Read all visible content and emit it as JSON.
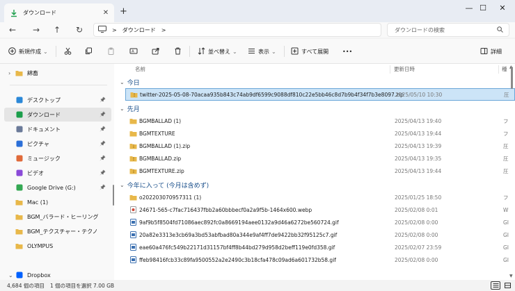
{
  "tab": {
    "label": "ダウンロード"
  },
  "window": {
    "minimize": "—",
    "maximize": "☐",
    "close": "✕"
  },
  "nav": {
    "back": "←",
    "forward": "→",
    "up": "↑",
    "refresh": "↻"
  },
  "address": {
    "crumb": "ダウンロード",
    "sep1": ">",
    "sep2": ">"
  },
  "search": {
    "placeholder": "ダウンロードの検索"
  },
  "toolbar": {
    "new": "新規作成",
    "sort": "並べ替え",
    "view": "表示",
    "expand_all": "すべて展開",
    "more": "•••",
    "details": "詳細"
  },
  "sidebar": {
    "items": [
      {
        "label": "綿畜",
        "icon": "folder-icon",
        "color": "#e8b84a",
        "expand": "›"
      },
      {
        "label": "デスクトップ",
        "icon": "desktop-icon",
        "color": "#2b88d8"
      },
      {
        "label": "ダウンロード",
        "icon": "download-icon",
        "color": "#1b9e4b"
      },
      {
        "label": "ドキュメント",
        "icon": "document-icon",
        "color": "#6b7a99"
      },
      {
        "label": "ピクチャ",
        "icon": "pictures-icon",
        "color": "#2b6fd8"
      },
      {
        "label": "ミュージック",
        "icon": "music-icon",
        "color": "#e06a3a"
      },
      {
        "label": "ビデオ",
        "icon": "video-icon",
        "color": "#8a4ad8"
      },
      {
        "label": "Google Drive (G:)",
        "icon": "google-drive-icon",
        "color": "#34a853"
      },
      {
        "label": "Mac (1)",
        "icon": "folder-icon",
        "color": "#e8b84a"
      },
      {
        "label": "BGM_バラード・ヒーリング",
        "icon": "folder-icon",
        "color": "#e8b84a"
      },
      {
        "label": "BGM_テクスチャー・テクノ",
        "icon": "folder-icon",
        "color": "#e8b84a"
      },
      {
        "label": "OLYMPUS",
        "icon": "folder-icon",
        "color": "#e8b84a"
      },
      {
        "label": "Dropbox",
        "icon": "dropbox-icon",
        "color": "#0061fe",
        "expand": "⌄"
      }
    ]
  },
  "columns": {
    "name": "名前",
    "date": "更新日時",
    "type": "種"
  },
  "groups": [
    {
      "title": "今日",
      "rows": [
        {
          "name": "twitter-2025-05-08-70acaa935b843c74ab9df6599c9088df810c22e5bb46c8d7b9b4f34f7b3e8097.zip",
          "date": "2025/05/10 10:30",
          "type": "圧",
          "icon": "zip-icon",
          "selected": true
        }
      ]
    },
    {
      "title": "先月",
      "rows": [
        {
          "name": "BGMBALLAD (1)",
          "date": "2025/04/13 19:40",
          "type": "フ",
          "icon": "folder-icon"
        },
        {
          "name": "BGMTEXTURE",
          "date": "2025/04/13 19:44",
          "type": "フ",
          "icon": "folder-icon"
        },
        {
          "name": "BGMBALLAD (1).zip",
          "date": "2025/04/13 19:39",
          "type": "圧",
          "icon": "zip-icon"
        },
        {
          "name": "BGMBALLAD.zip",
          "date": "2025/04/13 19:35",
          "type": "圧",
          "icon": "zip-icon"
        },
        {
          "name": "BGMTEXTURE.zip",
          "date": "2025/04/13 19:44",
          "type": "圧",
          "icon": "zip-icon"
        }
      ]
    },
    {
      "title": "今年に入って (今月は含めず)",
      "rows": [
        {
          "name": "o202203070957311 (1)",
          "date": "2025/01/25 18:50",
          "type": "フ",
          "icon": "folder-icon"
        },
        {
          "name": "24671-565-c7fac716437fbb2a60bbbecf0a2a9f5b-1464x600.webp",
          "date": "2025/02/08 0:01",
          "type": "W",
          "icon": "webp-icon"
        },
        {
          "name": "9af9b5f8504fd71086aec892fc0a8669194aee0132a9d46a6272be560724.gif",
          "date": "2025/02/08 0:00",
          "type": "GI",
          "icon": "gif-icon"
        },
        {
          "name": "20a82e3313e3cb69a3bd53abfbad80a344e9af4ff7de9422bb32f95125c7.gif",
          "date": "2025/02/08 0:00",
          "type": "GI",
          "icon": "gif-icon"
        },
        {
          "name": "eae60a476fc549b22171d31157bf4ff8b44bd279d958d2beff119e0fd358.gif",
          "date": "2025/02/07 23:59",
          "type": "GI",
          "icon": "gif-icon"
        },
        {
          "name": "ffeb98416fcb33c89fa9500552a2e2490c3b18cfa478c09ad6a601732b58.gif",
          "date": "2025/02/08 0:00",
          "type": "GI",
          "icon": "gif-icon"
        }
      ]
    }
  ],
  "status": {
    "count": "4,684 個の項目",
    "selected": "1 個の項目を選択 7.00 GB"
  },
  "colors": {
    "accent": "#0067c0",
    "selection": "#cce4f7",
    "group_title": "#1a4f8b"
  }
}
